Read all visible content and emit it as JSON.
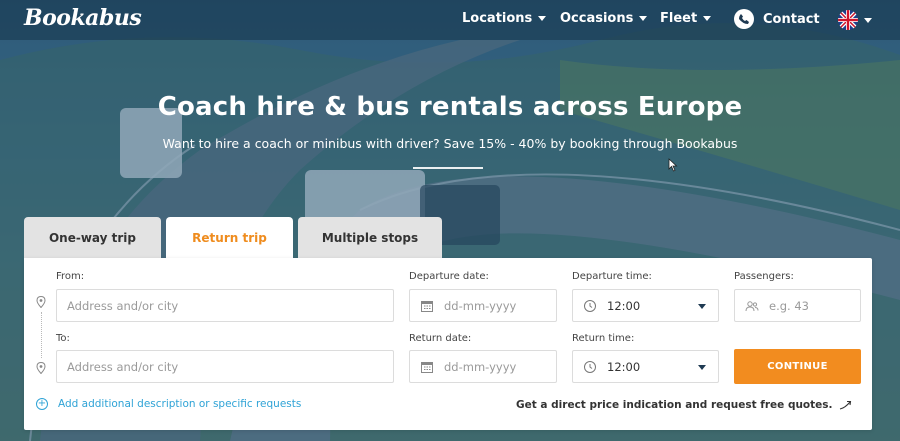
{
  "brand": {
    "logo": "Bookabus"
  },
  "nav": {
    "items": [
      {
        "label": "Locations"
      },
      {
        "label": "Occasions"
      },
      {
        "label": "Fleet"
      }
    ],
    "contact_label": "Contact"
  },
  "hero": {
    "title": "Coach hire & bus rentals across Europe",
    "subtitle": "Want to hire a coach or minibus with driver? Save 15% - 40% by booking through Bookabus"
  },
  "tabs": [
    {
      "label": "One-way trip",
      "active": false
    },
    {
      "label": "Return trip",
      "active": true
    },
    {
      "label": "Multiple stops",
      "active": false
    }
  ],
  "form": {
    "from": {
      "label": "From:",
      "placeholder": "Address and/or city"
    },
    "to": {
      "label": "To:",
      "placeholder": "Address and/or city"
    },
    "departure_date": {
      "label": "Departure date:",
      "placeholder": "dd-mm-yyyy"
    },
    "departure_time": {
      "label": "Departure time:",
      "value": "12:00"
    },
    "passengers": {
      "label": "Passengers:",
      "placeholder": "e.g. 43"
    },
    "return_date": {
      "label": "Return date:",
      "placeholder": "dd-mm-yyyy"
    },
    "return_time": {
      "label": "Return time:",
      "value": "12:00"
    },
    "continue_label": "CONTINUE",
    "add_description_label": "Add additional description or specific requests",
    "price_note": "Get a direct price indication and request free quotes."
  },
  "colors": {
    "accent_orange": "#f28c1f",
    "link_blue": "#2fa3d6",
    "active_tab_text": "#ef8c1e"
  },
  "icons": [
    "caret-down-icon",
    "phone-icon",
    "uk-flag-icon",
    "location-pin-icon",
    "calendar-icon",
    "clock-icon",
    "passengers-icon",
    "plus-circle-icon",
    "arrow-icon"
  ]
}
